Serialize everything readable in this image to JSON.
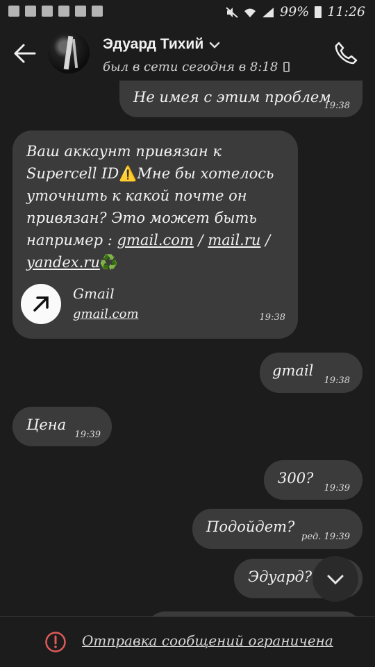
{
  "status_bar": {
    "battery": "99%",
    "time": "11:26"
  },
  "header": {
    "contact_name": "Эдуард Тихий",
    "last_seen": "был в сети сегодня в 8:18"
  },
  "messages": [
    {
      "text": "Не имея с этим проблем",
      "time": "19:38"
    },
    {
      "text_part1": "Ваш аккаунт привязан к Supercell ID",
      "emoji_warning": "⚠️",
      "text_part2": "Мне бы хотелось уточнить к какой почте он привязан? Это может быть например : ",
      "link1": "gmail.com",
      "sep1": " / ",
      "link2": "mail.ru",
      "sep2": " / ",
      "link3": "yandex.ru",
      "emoji_recycle": "♻️",
      "preview_title": "Gmail",
      "preview_url": "gmail.com",
      "time": "19:38"
    },
    {
      "text": "gmail",
      "time": "19:38"
    },
    {
      "text": "Цена",
      "time": "19:39"
    },
    {
      "text": "300?",
      "time": "19:39"
    },
    {
      "text": "Подойдет?",
      "time": "ред. 19:39"
    },
    {
      "text": "Эдуард?"
    }
  ],
  "footer": {
    "restriction_text": "Отправка сообщений ограничена"
  },
  "colors": {
    "background": "#1c1c1c",
    "bubble": "#3b3b3b",
    "warning_red": "#e05a5a"
  }
}
